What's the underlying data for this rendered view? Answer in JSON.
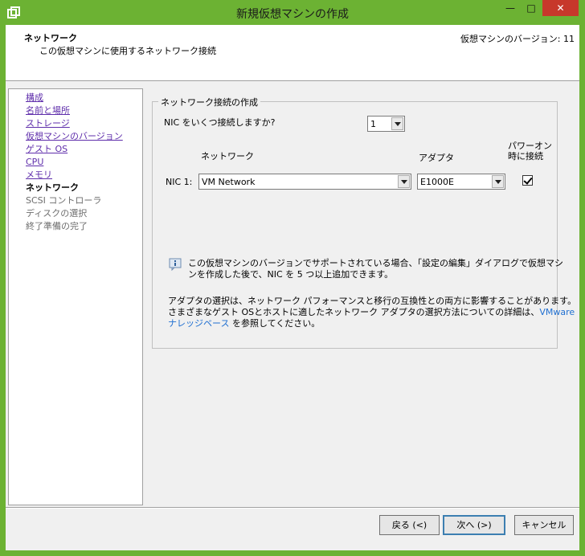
{
  "window": {
    "title": "新規仮想マシンの作成"
  },
  "header": {
    "title": "ネットワーク",
    "subtitle": "この仮想マシンに使用するネットワーク接続",
    "version": "仮想マシンのバージョン: 11"
  },
  "nav": {
    "items": [
      {
        "label": "構成",
        "state": "link"
      },
      {
        "label": "名前と場所",
        "state": "link"
      },
      {
        "label": "ストレージ",
        "state": "link"
      },
      {
        "label": "仮想マシンのバージョン",
        "state": "link"
      },
      {
        "label": "ゲスト OS",
        "state": "link"
      },
      {
        "label": "CPU",
        "state": "link"
      },
      {
        "label": "メモリ",
        "state": "link"
      },
      {
        "label": "ネットワーク",
        "state": "current"
      },
      {
        "label": "SCSI コントローラ",
        "state": "disabled"
      },
      {
        "label": "ディスクの選択",
        "state": "disabled"
      },
      {
        "label": "終了準備の完了",
        "state": "disabled"
      }
    ]
  },
  "group": {
    "legend": "ネットワーク接続の作成",
    "nic_count_question": "NIC をいくつ接続しますか?",
    "nic_count_value": "1",
    "col_network": "ネットワーク",
    "col_adapter": "アダプタ",
    "col_power_line1": "パワーオン",
    "col_power_line2": "時に接続",
    "nic1_label": "NIC 1:",
    "nic1_network": "VM Network",
    "nic1_adapter": "E1000E",
    "nic1_power_on": true,
    "info_line1": "この仮想マシンのバージョンでサポートされている場合、「設定の編集」ダイアログで仮想マシ",
    "info_line2": "ンを作成した後で、NIC を 5 つ以上追加できます。",
    "adapter_line1": "アダプタの選択は、ネットワーク パフォーマンスと移行の互換性との両方に影響することがあります。",
    "adapter_line2_a": "さまざまなゲスト OSとホストに適したネットワーク アダプタの選択方法についての詳細は、",
    "adapter_line2_link": "VMware",
    "adapter_line3_link": "ナレッジベース",
    "adapter_line3_b": " を参照してください。"
  },
  "buttons": {
    "back": "戻る (<)",
    "next": "次へ (>)",
    "cancel": "キャンセル"
  },
  "colors": {
    "titlebar": "#6cb233",
    "close": "#c7382b",
    "link_visited": "#5f2eab",
    "link_blue": "#1f6fd1"
  }
}
